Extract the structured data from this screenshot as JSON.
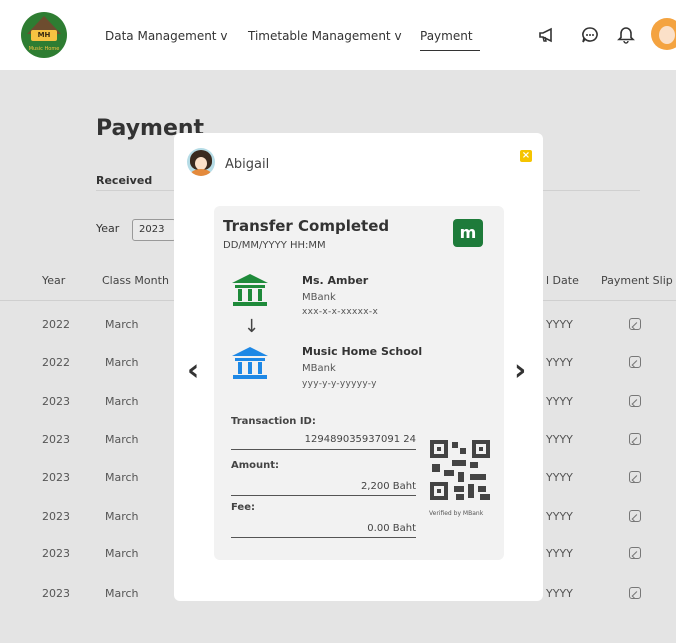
{
  "nav": {
    "logo_text": "MH",
    "logo_subtext": "Music Home",
    "items": [
      {
        "label": "Data Management v"
      },
      {
        "label": "Timetable Management v"
      },
      {
        "label": "Payment"
      }
    ]
  },
  "page": {
    "title": "Payment",
    "tab_received": "Received",
    "year_label": "Year",
    "year_value": "2023",
    "headers": {
      "year": "Year",
      "class_month": "Class Month",
      "approval_date": "l Date",
      "payment_slip": "Payment Slip"
    },
    "rows": [
      {
        "year": "2022",
        "month": "March",
        "date": "YYYY"
      },
      {
        "year": "2022",
        "month": "March",
        "date": "YYYY"
      },
      {
        "year": "2023",
        "month": "March",
        "date": "YYYY"
      },
      {
        "year": "2023",
        "month": "March",
        "date": "YYYY"
      },
      {
        "year": "2023",
        "month": "March",
        "date": "YYYY"
      },
      {
        "year": "2023",
        "month": "March",
        "date": "YYYY"
      },
      {
        "year": "2023",
        "month": "March",
        "date": "YYYY"
      },
      {
        "year": "2023",
        "month": "March",
        "date": "YYYY"
      }
    ]
  },
  "modal": {
    "student_name": "Abigail",
    "close_label": "×",
    "prev_label": "‹",
    "next_label": "›",
    "receipt": {
      "title": "Transfer Completed",
      "datetime": "DD/MM/YYYY HH:MM",
      "bank_logo": "m",
      "from": {
        "name": "Ms. Amber",
        "bank": "MBank",
        "account": "xxx-x-x-xxxxx-x"
      },
      "arrow": "↓",
      "to": {
        "name": "Music Home School",
        "bank": "MBank",
        "account": "yyy-y-y-yyyyy-y"
      },
      "transaction_id_label": "Transaction ID:",
      "transaction_id": "129489035937091 24",
      "amount_label": "Amount:",
      "amount": "2,200 Baht",
      "fee_label": "Fee:",
      "fee": "0.00 Baht",
      "verified": "Verified by MBank"
    }
  },
  "colors": {
    "brand_green": "#1e7b3a",
    "bank_icon_green": "#1e8a3a",
    "bank_icon_blue": "#1e88e5",
    "close_yellow": "#f5c400"
  }
}
